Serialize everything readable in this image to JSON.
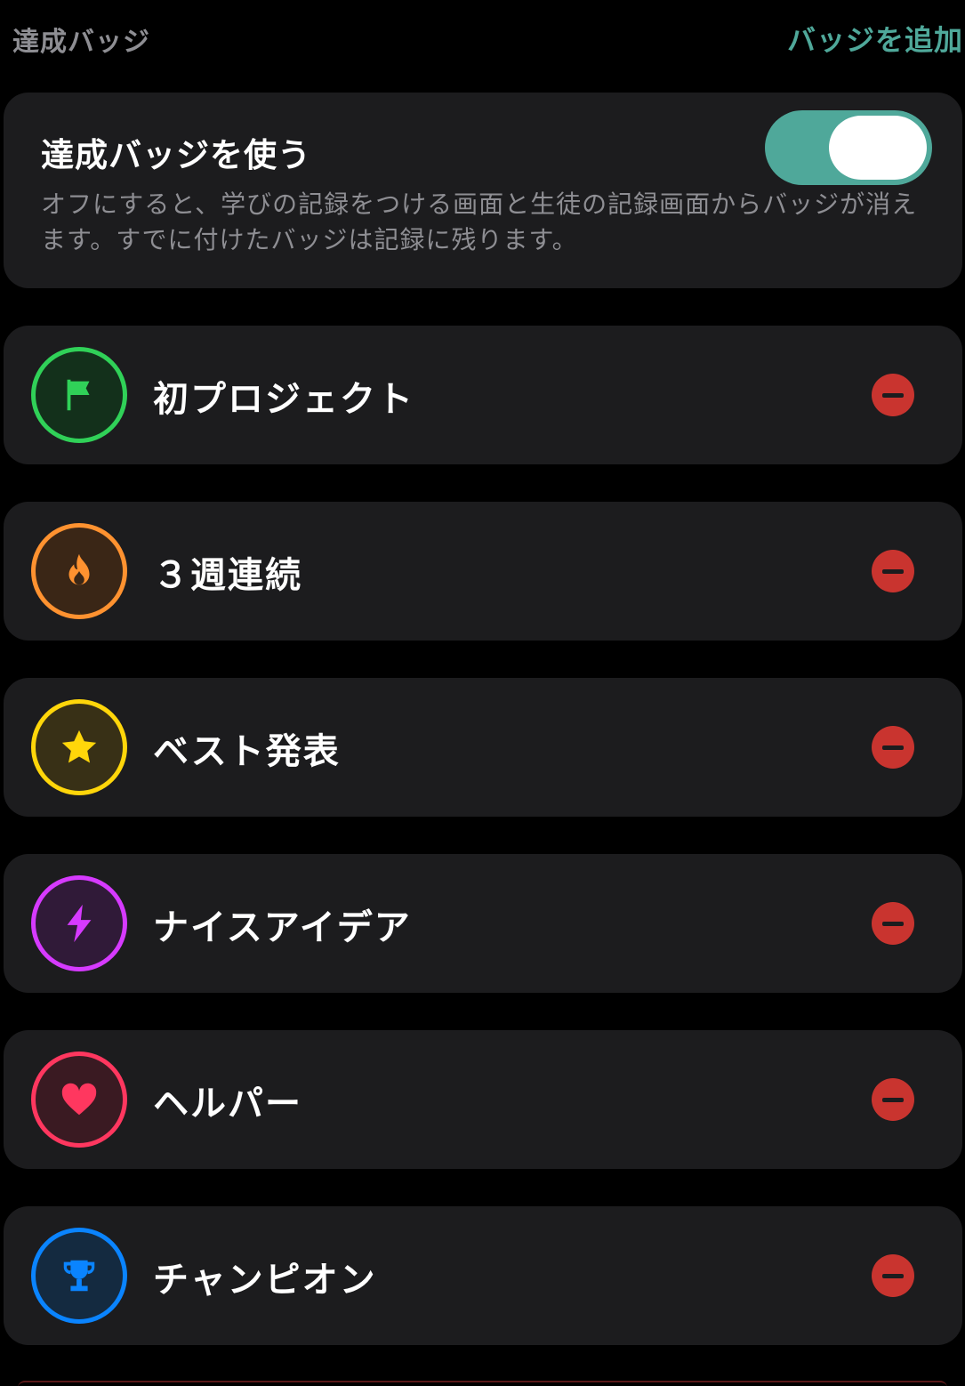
{
  "header": {
    "title": "達成バッジ",
    "add_label": "バッジを追加"
  },
  "toggle": {
    "title": "達成バッジを使う",
    "description": "オフにすると、学びの記録をつける画面と生徒の記録画面からバッジが消えます。すでに付けたバッジは記録に残ります。",
    "enabled": true,
    "accent_color": "#4fa89a"
  },
  "badges": [
    {
      "name": "初プロジェクト",
      "icon": "flag-icon",
      "color": "#30d158",
      "bg": "#13301b"
    },
    {
      "name": "３週連続",
      "icon": "flame-icon",
      "color": "#ff9230",
      "bg": "#3a2616"
    },
    {
      "name": "ベスト発表",
      "icon": "star-icon",
      "color": "#ffd60a",
      "bg": "#383016"
    },
    {
      "name": "ナイスアイデア",
      "icon": "bolt-icon",
      "color": "#d63aff",
      "bg": "#301a38"
    },
    {
      "name": "ヘルパー",
      "icon": "heart-icon",
      "color": "#ff375f",
      "bg": "#3a1a22"
    },
    {
      "name": "チャンピオン",
      "icon": "trophy-icon",
      "color": "#0a84ff",
      "bg": "#142a40"
    }
  ],
  "remove_color": "#c9342f"
}
